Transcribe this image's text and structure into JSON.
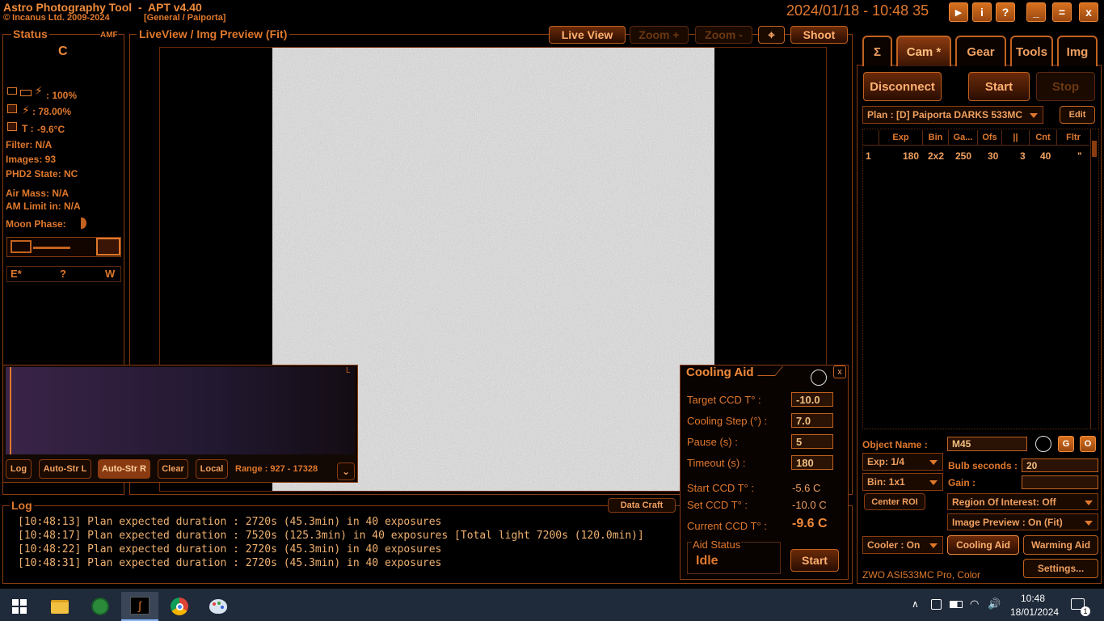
{
  "header": {
    "app_title": "Astro Photography Tool  -  APT v4.40",
    "copyright": "© Incanus Ltd. 2009-2024",
    "profile": "[General / Paiporta]",
    "datetime": "2024/01/18 - 10:48 35"
  },
  "title_buttons": {
    "play": "▶",
    "info": "i",
    "help": "?",
    "minimize": "_",
    "maximize": "=",
    "close": "x"
  },
  "status": {
    "title": "Status",
    "amf": "AMF",
    "connection": "C",
    "battery1": ": 100%",
    "battery2": ": 78.00%",
    "temp_label": "T :",
    "temp_value": "-9.6°C",
    "filter": "Filter: N/A",
    "images": "Images: 93",
    "phd2": "PHD2 State: NC",
    "airmass": "Air Mass: N/A",
    "am_limit": "AM Limit in: N/A",
    "moon_phase": "Moon Phase:",
    "nav_e": "E*",
    "nav_q": "?",
    "nav_w": "W"
  },
  "liveview": {
    "title": "LiveView / Img Preview (Fit)",
    "live_view": "Live View",
    "zoom_plus": "Zoom +",
    "zoom_minus": "Zoom -",
    "shoot": "Shoot"
  },
  "histogram": {
    "channel": "L",
    "log": "Log",
    "auto_str_l": "Auto-Str L",
    "auto_str_r": "Auto-Str R",
    "clear": "Clear",
    "local": "Local",
    "range": "Range : 927 - 17328"
  },
  "tabs": [
    {
      "label": "Σ",
      "active": false
    },
    {
      "label": "Cam *",
      "active": true
    },
    {
      "label": "Gear",
      "active": false
    },
    {
      "label": "Tools",
      "active": false
    },
    {
      "label": "Img",
      "active": false
    }
  ],
  "camera": {
    "disconnect": "Disconnect",
    "start": "Start",
    "stop": "Stop",
    "plan": "Plan : [D] Paiporta DARKS 533MC",
    "edit": "Edit",
    "columns": [
      "Exp",
      "Bin",
      "Ga...",
      "Ofs",
      "||",
      "Cnt",
      "Fltr"
    ],
    "rows": [
      {
        "idx": "1",
        "exp": "180",
        "bin": "2x2",
        "gain": "250",
        "ofs": "30",
        "pause": "3",
        "cnt": "40",
        "fltr": "\""
      }
    ],
    "object_label": "Object Name :",
    "object_value": "M45",
    "g": "G",
    "o": "O",
    "exp": "Exp: 1/4",
    "bulb_label": "Bulb seconds :",
    "bulb_value": "20",
    "bin": "Bin: 1x1",
    "gain_label": "Gain :",
    "gain_value": "",
    "center_roi": "Center ROI",
    "roi": "Region Of Interest: Off",
    "preview": "Image Preview : On (Fit)",
    "cooler": "Cooler : On",
    "cooling_aid": "Cooling Aid",
    "warming_aid": "Warming Aid",
    "camera_name": "ZWO ASI533MC Pro, Color",
    "settings": "Settings..."
  },
  "cooling_aid": {
    "title": "Cooling Aid",
    "close": "x",
    "target_label": "Target CCD T° :",
    "target_value": "-10.0",
    "step_label": "Cooling Step (°) :",
    "step_value": "7.0",
    "pause_label": "Pause (s) :",
    "pause_value": "5",
    "timeout_label": "Timeout (s) :",
    "timeout_value": "180",
    "start_label": "Start CCD T° :",
    "start_value": "-5.6 C",
    "set_label": "Set CCD T° :",
    "set_value": "-10.0 C",
    "current_label": "Current CCD T° :",
    "current_value": "-9.6 C",
    "aid_status_label": "Aid Status",
    "aid_status_value": "Idle",
    "start_button": "Start"
  },
  "log": {
    "title": "Log",
    "data_craft": "Data Craft",
    "lines": [
      "[10:48:13] Plan expected duration : 2720s (45.3min) in 40 exposures",
      "[10:48:17] Plan expected duration : 7520s (125.3min) in 40 exposures [Total light 7200s (120.0min)]",
      "[10:48:22] Plan expected duration : 2720s (45.3min) in 40 exposures",
      "[10:48:31] Plan expected duration : 2720s (45.3min) in 40 exposures"
    ]
  },
  "taskbar": {
    "time": "10:48",
    "date": "18/01/2024",
    "notifications": "1"
  },
  "colors": {
    "accent": "#e0782c",
    "background": "#000000",
    "taskbar": "#1f2a3a"
  }
}
